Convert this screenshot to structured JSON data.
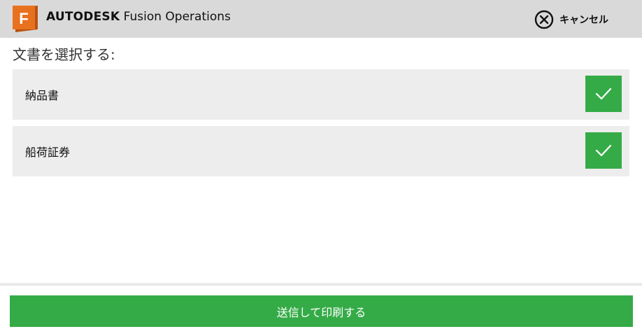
{
  "header": {
    "logo_letter": "F",
    "brand_strong": "AUTODESK",
    "brand_light": "Fusion Operations",
    "cancel_label": "キャンセル",
    "logo_color": "#e8711f",
    "background": "#d9d9d9"
  },
  "main": {
    "title": "文書を選択する:",
    "documents": [
      {
        "label": "納品書",
        "checked": true,
        "icon": "checkmark-icon"
      },
      {
        "label": "船荷証券",
        "checked": true,
        "icon": "checkmark-icon"
      }
    ],
    "check_color": "#35ab47",
    "item_background": "#ededed"
  },
  "footer": {
    "submit_label": "送信して印刷する",
    "button_color": "#35ab47"
  }
}
